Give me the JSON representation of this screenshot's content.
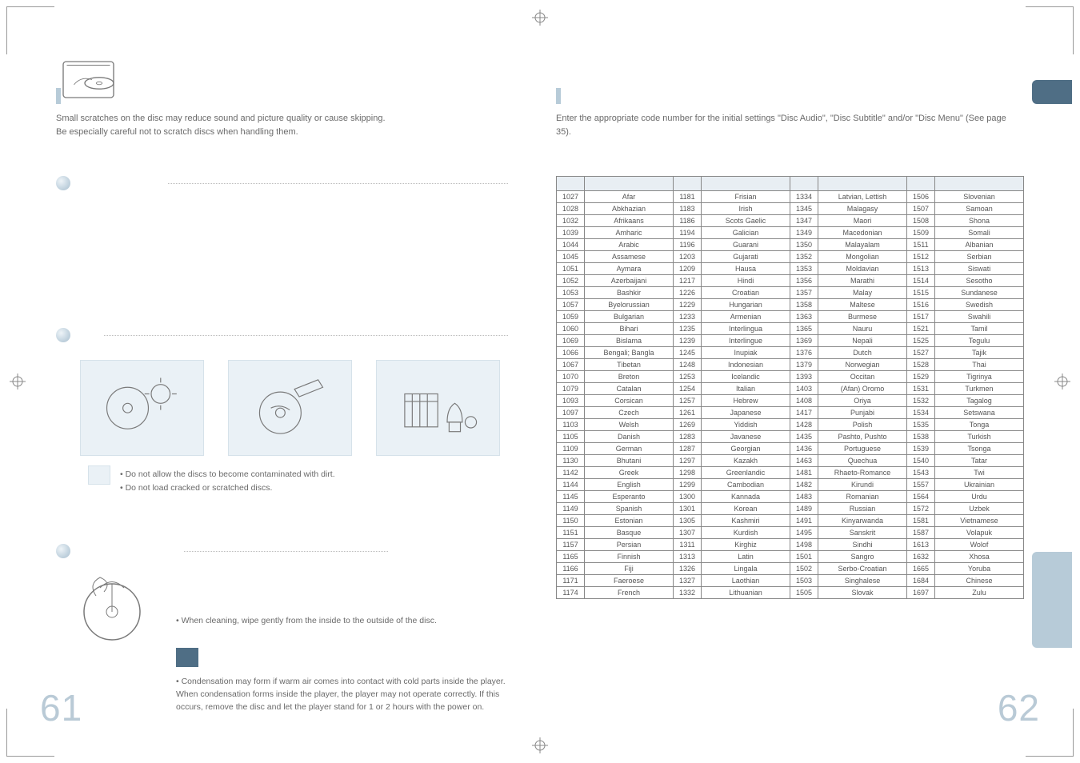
{
  "left": {
    "intro_line1": "Small scratches on the disc may reduce sound and picture quality or cause skipping.",
    "intro_line2": "Be especially careful not to scratch discs when handling them.",
    "bullet1": "• Do not allow the discs to become contaminated with dirt.",
    "bullet2": "• Do not load cracked or scratched discs.",
    "clean_bullet": "• When cleaning, wipe gently from the inside to the outside of the disc.",
    "caution_text": "• Condensation may form if warm air comes into contact with cold parts inside the player. When condensation forms inside the player, the player may not operate correctly. If this occurs, remove the disc and let the player stand for 1 or 2 hours with the power on.",
    "page_number": "61"
  },
  "right": {
    "intro": "Enter the appropriate code number for the initial settings \"Disc Audio\", \"Disc Subtitle\" and/or \"Disc Menu\" (See page 35).",
    "page_number": "62",
    "table": [
      [
        "1027",
        "Afar",
        "1181",
        "Frisian",
        "1334",
        "Latvian, Lettish",
        "1506",
        "Slovenian"
      ],
      [
        "1028",
        "Abkhazian",
        "1183",
        "Irish",
        "1345",
        "Malagasy",
        "1507",
        "Samoan"
      ],
      [
        "1032",
        "Afrikaans",
        "1186",
        "Scots Gaelic",
        "1347",
        "Maori",
        "1508",
        "Shona"
      ],
      [
        "1039",
        "Amharic",
        "1194",
        "Galician",
        "1349",
        "Macedonian",
        "1509",
        "Somali"
      ],
      [
        "1044",
        "Arabic",
        "1196",
        "Guarani",
        "1350",
        "Malayalam",
        "1511",
        "Albanian"
      ],
      [
        "1045",
        "Assamese",
        "1203",
        "Gujarati",
        "1352",
        "Mongolian",
        "1512",
        "Serbian"
      ],
      [
        "1051",
        "Aymara",
        "1209",
        "Hausa",
        "1353",
        "Moldavian",
        "1513",
        "Siswati"
      ],
      [
        "1052",
        "Azerbaijani",
        "1217",
        "Hindi",
        "1356",
        "Marathi",
        "1514",
        "Sesotho"
      ],
      [
        "1053",
        "Bashkir",
        "1226",
        "Croatian",
        "1357",
        "Malay",
        "1515",
        "Sundanese"
      ],
      [
        "1057",
        "Byelorussian",
        "1229",
        "Hungarian",
        "1358",
        "Maltese",
        "1516",
        "Swedish"
      ],
      [
        "1059",
        "Bulgarian",
        "1233",
        "Armenian",
        "1363",
        "Burmese",
        "1517",
        "Swahili"
      ],
      [
        "1060",
        "Bihari",
        "1235",
        "Interlingua",
        "1365",
        "Nauru",
        "1521",
        "Tamil"
      ],
      [
        "1069",
        "Bislama",
        "1239",
        "Interlingue",
        "1369",
        "Nepali",
        "1525",
        "Tegulu"
      ],
      [
        "1066",
        "Bengali; Bangla",
        "1245",
        "Inupiak",
        "1376",
        "Dutch",
        "1527",
        "Tajik"
      ],
      [
        "1067",
        "Tibetan",
        "1248",
        "Indonesian",
        "1379",
        "Norwegian",
        "1528",
        "Thai"
      ],
      [
        "1070",
        "Breton",
        "1253",
        "Icelandic",
        "1393",
        "Occitan",
        "1529",
        "Tigrinya"
      ],
      [
        "1079",
        "Catalan",
        "1254",
        "Italian",
        "1403",
        "(Afan) Oromo",
        "1531",
        "Turkmen"
      ],
      [
        "1093",
        "Corsican",
        "1257",
        "Hebrew",
        "1408",
        "Oriya",
        "1532",
        "Tagalog"
      ],
      [
        "1097",
        "Czech",
        "1261",
        "Japanese",
        "1417",
        "Punjabi",
        "1534",
        "Setswana"
      ],
      [
        "1103",
        "Welsh",
        "1269",
        "Yiddish",
        "1428",
        "Polish",
        "1535",
        "Tonga"
      ],
      [
        "1105",
        "Danish",
        "1283",
        "Javanese",
        "1435",
        "Pashto, Pushto",
        "1538",
        "Turkish"
      ],
      [
        "1109",
        "German",
        "1287",
        "Georgian",
        "1436",
        "Portuguese",
        "1539",
        "Tsonga"
      ],
      [
        "1130",
        "Bhutani",
        "1297",
        "Kazakh",
        "1463",
        "Quechua",
        "1540",
        "Tatar"
      ],
      [
        "1142",
        "Greek",
        "1298",
        "Greenlandic",
        "1481",
        "Rhaeto-Romance",
        "1543",
        "Twi"
      ],
      [
        "1144",
        "English",
        "1299",
        "Cambodian",
        "1482",
        "Kirundi",
        "1557",
        "Ukrainian"
      ],
      [
        "1145",
        "Esperanto",
        "1300",
        "Kannada",
        "1483",
        "Romanian",
        "1564",
        "Urdu"
      ],
      [
        "1149",
        "Spanish",
        "1301",
        "Korean",
        "1489",
        "Russian",
        "1572",
        "Uzbek"
      ],
      [
        "1150",
        "Estonian",
        "1305",
        "Kashmiri",
        "1491",
        "Kinyarwanda",
        "1581",
        "Vietnamese"
      ],
      [
        "1151",
        "Basque",
        "1307",
        "Kurdish",
        "1495",
        "Sanskrit",
        "1587",
        "Volapuk"
      ],
      [
        "1157",
        "Persian",
        "1311",
        "Kirghiz",
        "1498",
        "Sindhi",
        "1613",
        "Wolof"
      ],
      [
        "1165",
        "Finnish",
        "1313",
        "Latin",
        "1501",
        "Sangro",
        "1632",
        "Xhosa"
      ],
      [
        "1166",
        "Fiji",
        "1326",
        "Lingala",
        "1502",
        "Serbo-Croatian",
        "1665",
        "Yoruba"
      ],
      [
        "1171",
        "Faeroese",
        "1327",
        "Laothian",
        "1503",
        "Singhalese",
        "1684",
        "Chinese"
      ],
      [
        "1174",
        "French",
        "1332",
        "Lithuanian",
        "1505",
        "Slovak",
        "1697",
        "Zulu"
      ]
    ]
  }
}
